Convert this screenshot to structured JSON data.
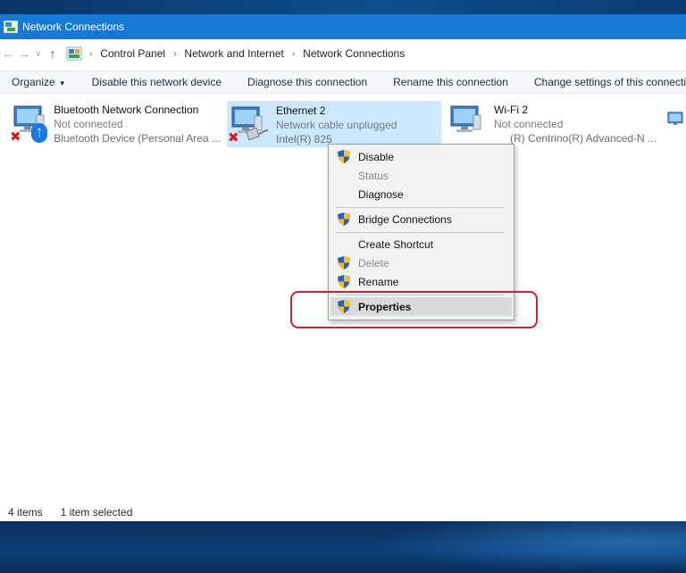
{
  "window": {
    "title": "Network Connections"
  },
  "address": {
    "breadcrumbs": [
      "Control Panel",
      "Network and Internet",
      "Network Connections"
    ]
  },
  "commands": {
    "organize": "Organize",
    "disable_device": "Disable this network device",
    "diagnose": "Diagnose this connection",
    "rename": "Rename this connection",
    "change_settings": "Change settings of this connection"
  },
  "connections": [
    {
      "name": "Bluetooth Network Connection",
      "status": "Not connected",
      "device": "Bluetooth Device (Personal Area ...",
      "badge": "bluetooth-icon"
    },
    {
      "name": "Ethernet 2",
      "status": "Network cable unplugged",
      "device": "Intel(R) 825",
      "badge": "ethernet-cable-icon",
      "selected": true
    },
    {
      "name": "Wi-Fi 2",
      "status": "Not connected",
      "device": "(R) Centrino(R) Advanced-N ...",
      "badge": "wifi-icon"
    }
  ],
  "context_menu": {
    "items": [
      {
        "label": "Disable",
        "shield": true,
        "enabled": true
      },
      {
        "label": "Status",
        "shield": false,
        "enabled": false
      },
      {
        "label": "Diagnose",
        "shield": false,
        "enabled": true
      },
      {
        "label": "Bridge Connections",
        "shield": true,
        "enabled": true
      },
      {
        "label": "Create Shortcut",
        "shield": false,
        "enabled": true
      },
      {
        "label": "Delete",
        "shield": true,
        "enabled": false
      },
      {
        "label": "Rename",
        "shield": true,
        "enabled": true
      },
      {
        "label": "Properties",
        "shield": true,
        "enabled": true,
        "highlighted": true
      }
    ]
  },
  "statusbar": {
    "item_count": "4 items",
    "selection": "1 item selected"
  },
  "colors": {
    "titlebar": "#1679d4",
    "selection": "#cce8ff",
    "highlight_ring": "#c0262d"
  }
}
